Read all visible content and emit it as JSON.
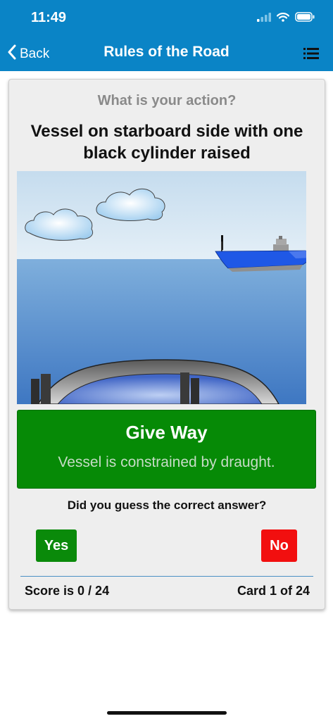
{
  "status_bar": {
    "time": "11:49"
  },
  "nav": {
    "back_label": "Back",
    "title": "Rules of the Road"
  },
  "card": {
    "question_label": "What is your action?",
    "question": "Vessel on starboard side with one black cylinder raised",
    "answer": {
      "title": "Give Way",
      "subtitle": "Vessel is constrained by draught."
    },
    "prompt": "Did you guess the correct answer?",
    "yes_label": "Yes",
    "no_label": "No",
    "score_text": "Score is 0 / 24",
    "card_text": "Card 1 of 24"
  },
  "colors": {
    "nav_blue": "#0a84c6",
    "answer_green": "#068a06",
    "yes_green": "#0a8a0a",
    "no_red": "#f20f0f"
  },
  "icons": [
    "signal-icon",
    "wifi-icon",
    "battery-icon",
    "chevron-left-icon",
    "list-icon"
  ]
}
